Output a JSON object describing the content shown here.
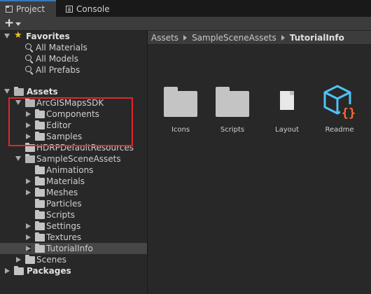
{
  "tabs": [
    {
      "label": "Project",
      "icon": "folder-icon",
      "active": true
    },
    {
      "label": "Console",
      "icon": "console-icon",
      "active": false
    }
  ],
  "toolbar": {
    "add_label": "+"
  },
  "favorites": {
    "label": "Favorites",
    "items": [
      "All Materials",
      "All Models",
      "All Prefabs"
    ]
  },
  "assets": {
    "label": "Assets",
    "arcgis": {
      "label": "ArcGISMapsSDK",
      "children": [
        "Components",
        "Editor",
        "Samples"
      ]
    },
    "hdrp": "HDRPDefaultResources",
    "sample_scene": {
      "label": "SampleSceneAssets",
      "children": [
        "Animations",
        "Materials",
        "Meshes",
        "Particles",
        "Scripts",
        "Settings",
        "Textures",
        "TutorialInfo"
      ]
    },
    "scenes": "Scenes"
  },
  "packages": "Packages",
  "breadcrumb": [
    "Assets",
    "SampleSceneAssets",
    "TutorialInfo"
  ],
  "grid_items": [
    {
      "label": "Icons",
      "icon": "folder-icon"
    },
    {
      "label": "Scripts",
      "icon": "folder-icon"
    },
    {
      "label": "Layout",
      "icon": "document-icon"
    },
    {
      "label": "Readme",
      "icon": "readme-asset-icon"
    }
  ],
  "colors": {
    "accent": "#3a79bb",
    "highlight": "#e0262b",
    "readme_cube": "#4fc3f7",
    "readme_braces": "#ff6b2d"
  }
}
